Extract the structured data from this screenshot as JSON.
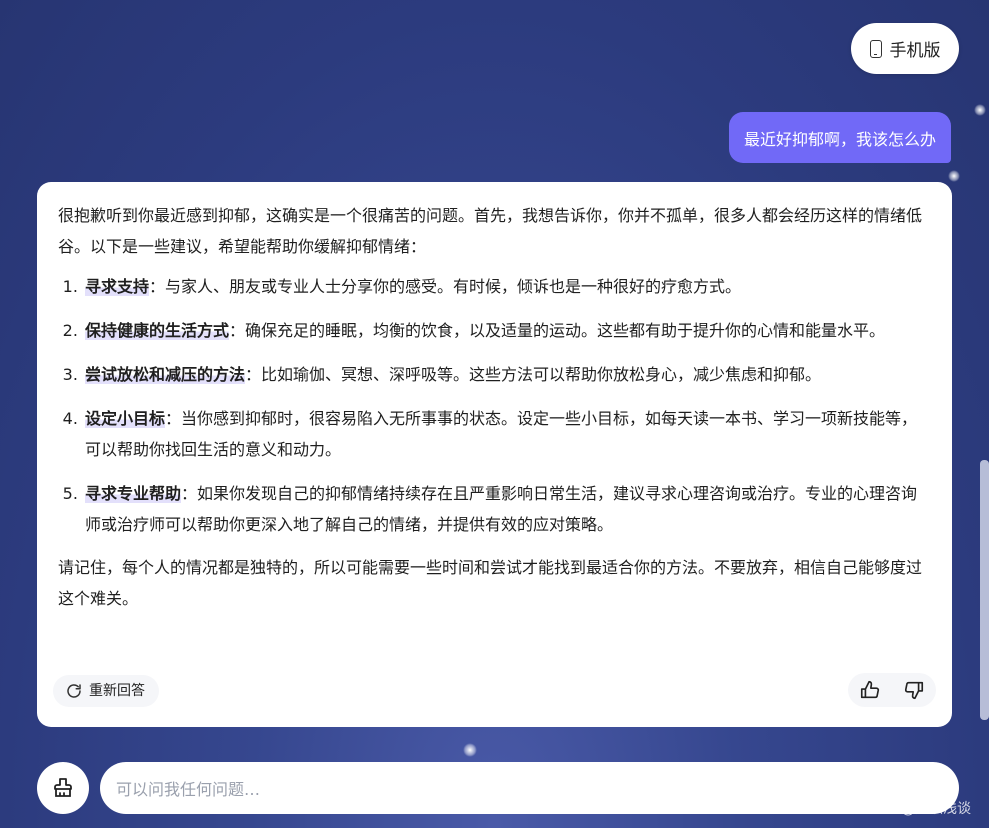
{
  "header": {
    "mobile_label": "手机版"
  },
  "user_message": "最近好抑郁啊，我该怎么办",
  "answer": {
    "intro": "很抱歉听到你最近感到抑郁，这确实是一个很痛苦的问题。首先，我想告诉你，你并不孤单，很多人都会经历这样的情绪低谷。以下是一些建议，希望能帮助你缓解抑郁情绪：",
    "items": [
      {
        "title": "寻求支持",
        "text": "：与家人、朋友或专业人士分享你的感受。有时候，倾诉也是一种很好的疗愈方式。"
      },
      {
        "title": "保持健康的生活方式",
        "text": "：确保充足的睡眠，均衡的饮食，以及适量的运动。这些都有助于提升你的心情和能量水平。"
      },
      {
        "title": "尝试放松和减压的方法",
        "text": "：比如瑜伽、冥想、深呼吸等。这些方法可以帮助你放松身心，减少焦虑和抑郁。"
      },
      {
        "title": "设定小目标",
        "text": "：当你感到抑郁时，很容易陷入无所事事的状态。设定一些小目标，如每天读一本书、学习一项新技能等，可以帮助你找回生活的意义和动力。"
      },
      {
        "title": "寻求专业帮助",
        "text": "：如果你发现自己的抑郁情绪持续存在且严重影响日常生活，建议寻求心理咨询或治疗。专业的心理咨询师或治疗师可以帮助你更深入地了解自己的情绪，并提供有效的应对策略。"
      }
    ],
    "closing": "请记住，每个人的情况都是独特的，所以可能需要一些时间和尝试才能找到最适合你的方法。不要放弃，相信自己能够度过这个难关。",
    "regenerate_label": "重新回答"
  },
  "input": {
    "placeholder": "可以问我任何问题…"
  },
  "watermark": "CSDN @知识浅谈",
  "colors": {
    "accent": "#7169f7",
    "background": "#2c3b7e"
  }
}
